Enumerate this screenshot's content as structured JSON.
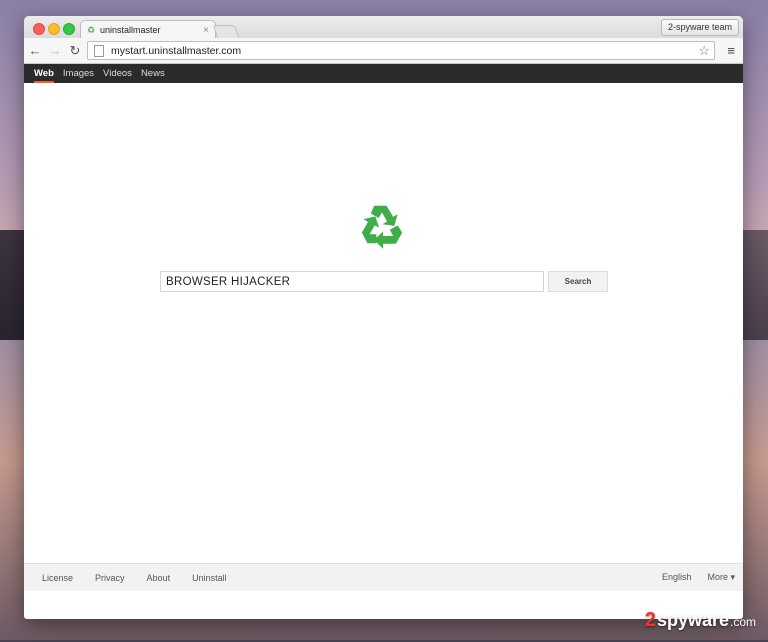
{
  "browser": {
    "tab_title": "uninstallmaster",
    "tab_close": "×",
    "profile_label": "2-spyware team",
    "url": "mystart.uninstallmaster.com"
  },
  "nav": {
    "items": [
      {
        "label": "Web"
      },
      {
        "label": "Images"
      },
      {
        "label": "Videos"
      },
      {
        "label": "News"
      }
    ]
  },
  "search": {
    "value": "BROWSER HIJACKER",
    "button_label": "Search"
  },
  "footer": {
    "left": [
      "License",
      "Privacy",
      "About",
      "Uninstall"
    ],
    "language": "English",
    "more": "More ▾"
  },
  "watermark": {
    "digit": "2",
    "brand": "spyware",
    "tld": ".com"
  },
  "colors": {
    "logo_green": "#3fae49",
    "nav_active_underline": "#e8642b",
    "nav_background": "#2b2b2b"
  },
  "icons": [
    "back-arrow-icon",
    "forward-arrow-icon",
    "reload-icon",
    "page-icon",
    "star-icon",
    "menu-icon",
    "recycle-icon"
  ]
}
